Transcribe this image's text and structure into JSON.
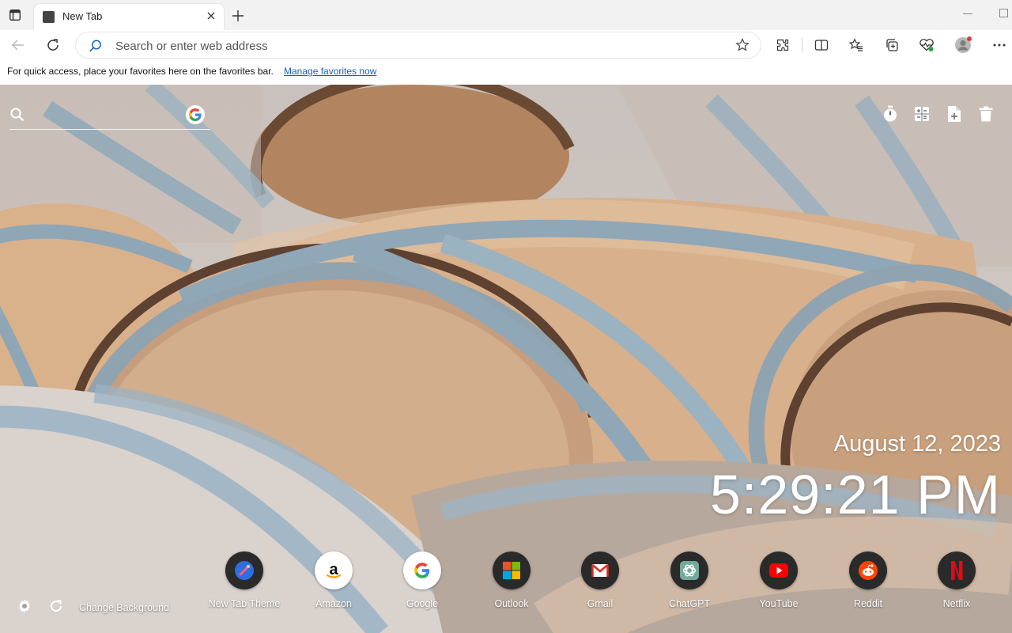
{
  "tab": {
    "title": "New Tab"
  },
  "address_bar": {
    "placeholder": "Search or enter web address",
    "value": ""
  },
  "favorites_bar": {
    "message": "For quick access, place your favorites here on the favorites bar.",
    "link": "Manage favorites now"
  },
  "new_tab": {
    "search_placeholder": "",
    "date": "August 12, 2023",
    "time": "5:29:21 PM",
    "change_background": "Change Background",
    "shortcuts": [
      {
        "label": "New Tab Theme"
      },
      {
        "label": "Amazon"
      },
      {
        "label": "Google"
      },
      {
        "label": "Outlook"
      },
      {
        "label": "Gmail"
      },
      {
        "label": "ChatGPT"
      },
      {
        "label": "YouTube"
      },
      {
        "label": "Reddit"
      },
      {
        "label": "Netflix"
      }
    ]
  },
  "colors": {
    "link": "#1a5fb4",
    "tabstrip": "#f2f2f2",
    "shortcut_bg": "#2a2a2a",
    "profile_badge": "#e53935"
  },
  "icons": {
    "toolbar": [
      "back-arrow-icon",
      "refresh-icon",
      "search-icon",
      "star-icon",
      "extensions-icon",
      "split-screen-icon",
      "favorites-icon",
      "collections-icon",
      "performance-icon",
      "profile-icon",
      "more-icon"
    ],
    "new_tab_tools": [
      "timer-icon",
      "calculator-icon",
      "add-note-icon",
      "trash-icon"
    ],
    "bottom": [
      "settings-gear-icon",
      "reload-icon"
    ]
  }
}
